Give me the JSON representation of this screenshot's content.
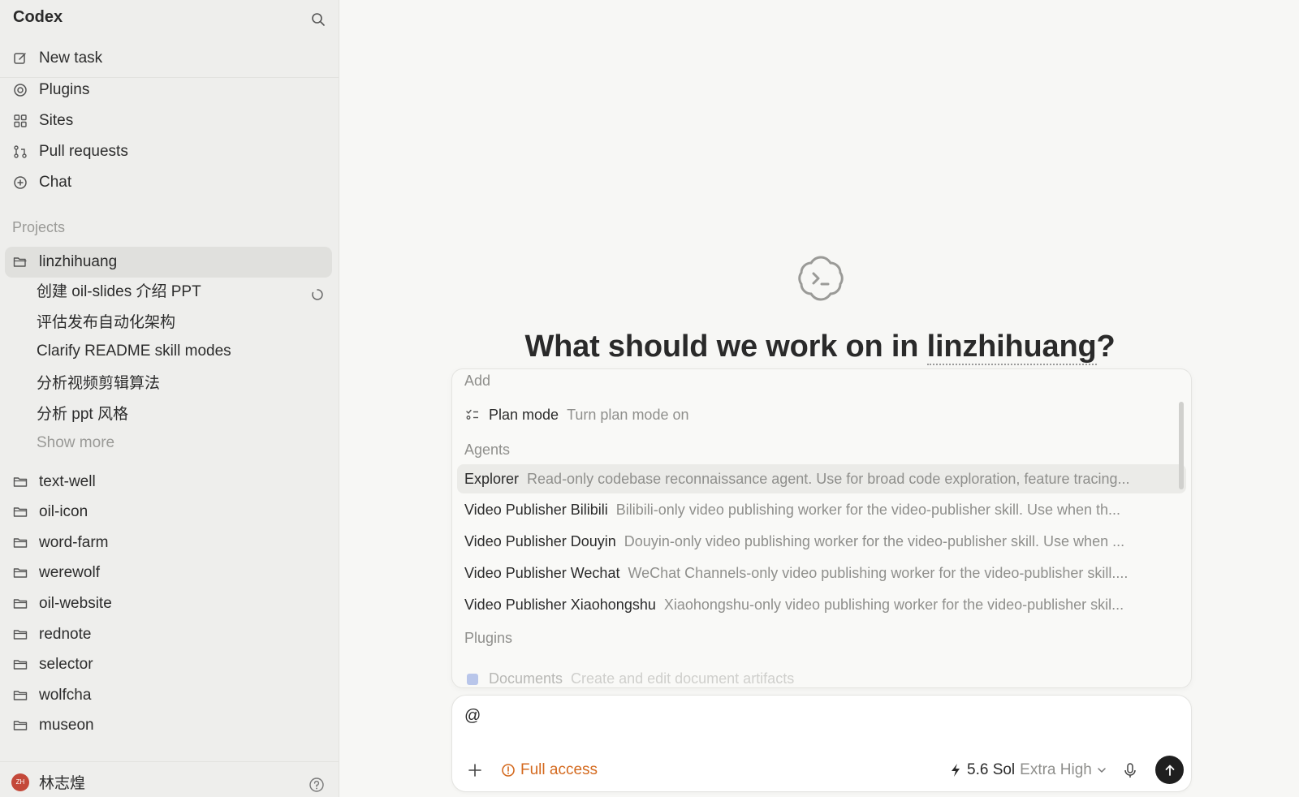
{
  "app": {
    "title": "Codex"
  },
  "sidebar": {
    "nav": [
      {
        "label": "New task",
        "icon": "pencil-square-icon"
      },
      {
        "label": "Plugins",
        "icon": "at-sign-icon"
      },
      {
        "label": "Sites",
        "icon": "grid-icon"
      },
      {
        "label": "Pull requests",
        "icon": "git-pull-request-icon"
      },
      {
        "label": "Chat",
        "icon": "plus-circle-icon"
      }
    ],
    "projects_label": "Projects",
    "active_project": "linzhihuang",
    "tasks": [
      "创建 oil-slides 介绍 PPT",
      "评估发布自动化架构",
      "Clarify README skill modes",
      "分析视频剪辑算法",
      "分析 ppt 风格"
    ],
    "show_more": "Show more",
    "projects": [
      "text-well",
      "oil-icon",
      "word-farm",
      "werewolf",
      "oil-website",
      "rednote",
      "selector",
      "wolfcha",
      "museon"
    ],
    "user": {
      "initials": "ZH",
      "name": "林志煌"
    }
  },
  "main": {
    "headline_prefix": "What should we work on in ",
    "headline_project": "linzhihuang",
    "headline_suffix": "?",
    "popover": {
      "add_label": "Add",
      "plan_mode": {
        "name": "Plan mode",
        "desc": "Turn plan mode on"
      },
      "agents_label": "Agents",
      "agents": [
        {
          "name": "Explorer",
          "desc": "Read-only codebase reconnaissance agent. Use for broad code exploration, feature tracing..."
        },
        {
          "name": "Video Publisher Bilibili",
          "desc": "Bilibili-only video publishing worker for the video-publisher skill. Use when th..."
        },
        {
          "name": "Video Publisher Douyin",
          "desc": "Douyin-only video publishing worker for the video-publisher skill. Use when ..."
        },
        {
          "name": "Video Publisher Wechat",
          "desc": "WeChat Channels-only video publishing worker for the video-publisher skill...."
        },
        {
          "name": "Video Publisher Xiaohongshu",
          "desc": "Xiaohongshu-only video publishing worker for the video-publisher skil..."
        }
      ],
      "plugins_label": "Plugins",
      "plugin_partial": {
        "name": "Documents",
        "desc": "Create and edit document artifacts"
      }
    },
    "composer": {
      "input_value": "@",
      "access_label": "Full access",
      "model_name": "5.6 Sol",
      "model_effort": "Extra High"
    }
  },
  "colors": {
    "accent_orange": "#d46a1f",
    "sidebar_bg": "#eeeeec",
    "main_bg": "#f7f7f5",
    "send_bg": "#1f1f1f"
  }
}
